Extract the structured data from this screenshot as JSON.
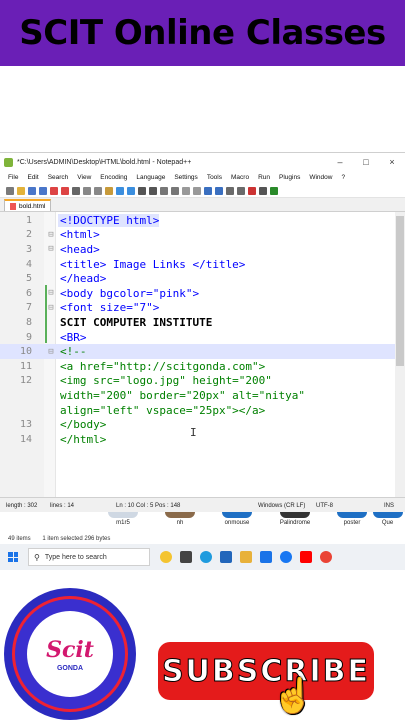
{
  "banner": {
    "title": "SCIT Online Classes"
  },
  "window": {
    "title": "*C:\\Users\\ADMIN\\Desktop\\HTML\\bold.html - Notepad++",
    "controls": {
      "minimize": "–",
      "maximize": "□",
      "close": "×"
    }
  },
  "menu": [
    "File",
    "Edit",
    "Search",
    "View",
    "Encoding",
    "Language",
    "Settings",
    "Tools",
    "Macro",
    "Run",
    "Plugins",
    "Window",
    "?"
  ],
  "tab": {
    "label": "bold.html"
  },
  "editor": {
    "lines": [
      {
        "num": "1",
        "fold": "",
        "code": "<!DOCTYPE html>"
      },
      {
        "num": "2",
        "fold": "⊟",
        "code": "<html>"
      },
      {
        "num": "3",
        "fold": "⊟",
        "code": "<head>"
      },
      {
        "num": "4",
        "fold": "",
        "code": "<title> Image Links </title>"
      },
      {
        "num": "5",
        "fold": "",
        "code": "</head>"
      },
      {
        "num": "6",
        "fold": "⊟",
        "code": "<body bgcolor=\"pink\">"
      },
      {
        "num": "7",
        "fold": "⊟",
        "code": "<font size=\"7\">"
      },
      {
        "num": "8",
        "fold": "",
        "code": "SCIT COMPUTER INSTITUTE"
      },
      {
        "num": "9",
        "fold": "",
        "code": "<BR>"
      },
      {
        "num": "10",
        "fold": "⊟",
        "code": "<!--"
      },
      {
        "num": "11",
        "fold": "",
        "code": "<a href=\"http://scitgonda.com\">"
      },
      {
        "num": "12",
        "fold": "",
        "code": "<img src=\"logo.jpg\" height=\"200\""
      },
      {
        "num": "",
        "fold": "",
        "code": "width=\"200\" border=\"20px\" alt=\"nitya\""
      },
      {
        "num": "",
        "fold": "",
        "code": "align=\"left\" vspace=\"25px\"></a>"
      },
      {
        "num": "13",
        "fold": "",
        "code": "</body>"
      },
      {
        "num": "14",
        "fold": "",
        "code": "</html>"
      }
    ]
  },
  "status": {
    "length": "length : 302",
    "lines": "lines : 14",
    "position": "Ln : 10   Col : 5   Pos : 148",
    "eol": "Windows (CR LF)",
    "encoding": "UTF-8",
    "mode": "INS"
  },
  "explorer": {
    "items": [
      "m1r5",
      "nh",
      "onmouse",
      "Palindrome",
      "poster",
      "Que"
    ],
    "status_count": "49 items",
    "status_selected": "1 item selected  296 bytes"
  },
  "taskbar": {
    "search_placeholder": "Type here to search"
  },
  "logo": {
    "word": "Scit",
    "sub": "GONDA"
  },
  "subscribe": {
    "label": "SUBSCRIBE"
  },
  "colors": {
    "banner": "#6a1fb6",
    "subscribe": "#e41b1b",
    "logo": "#2b2bbf"
  }
}
